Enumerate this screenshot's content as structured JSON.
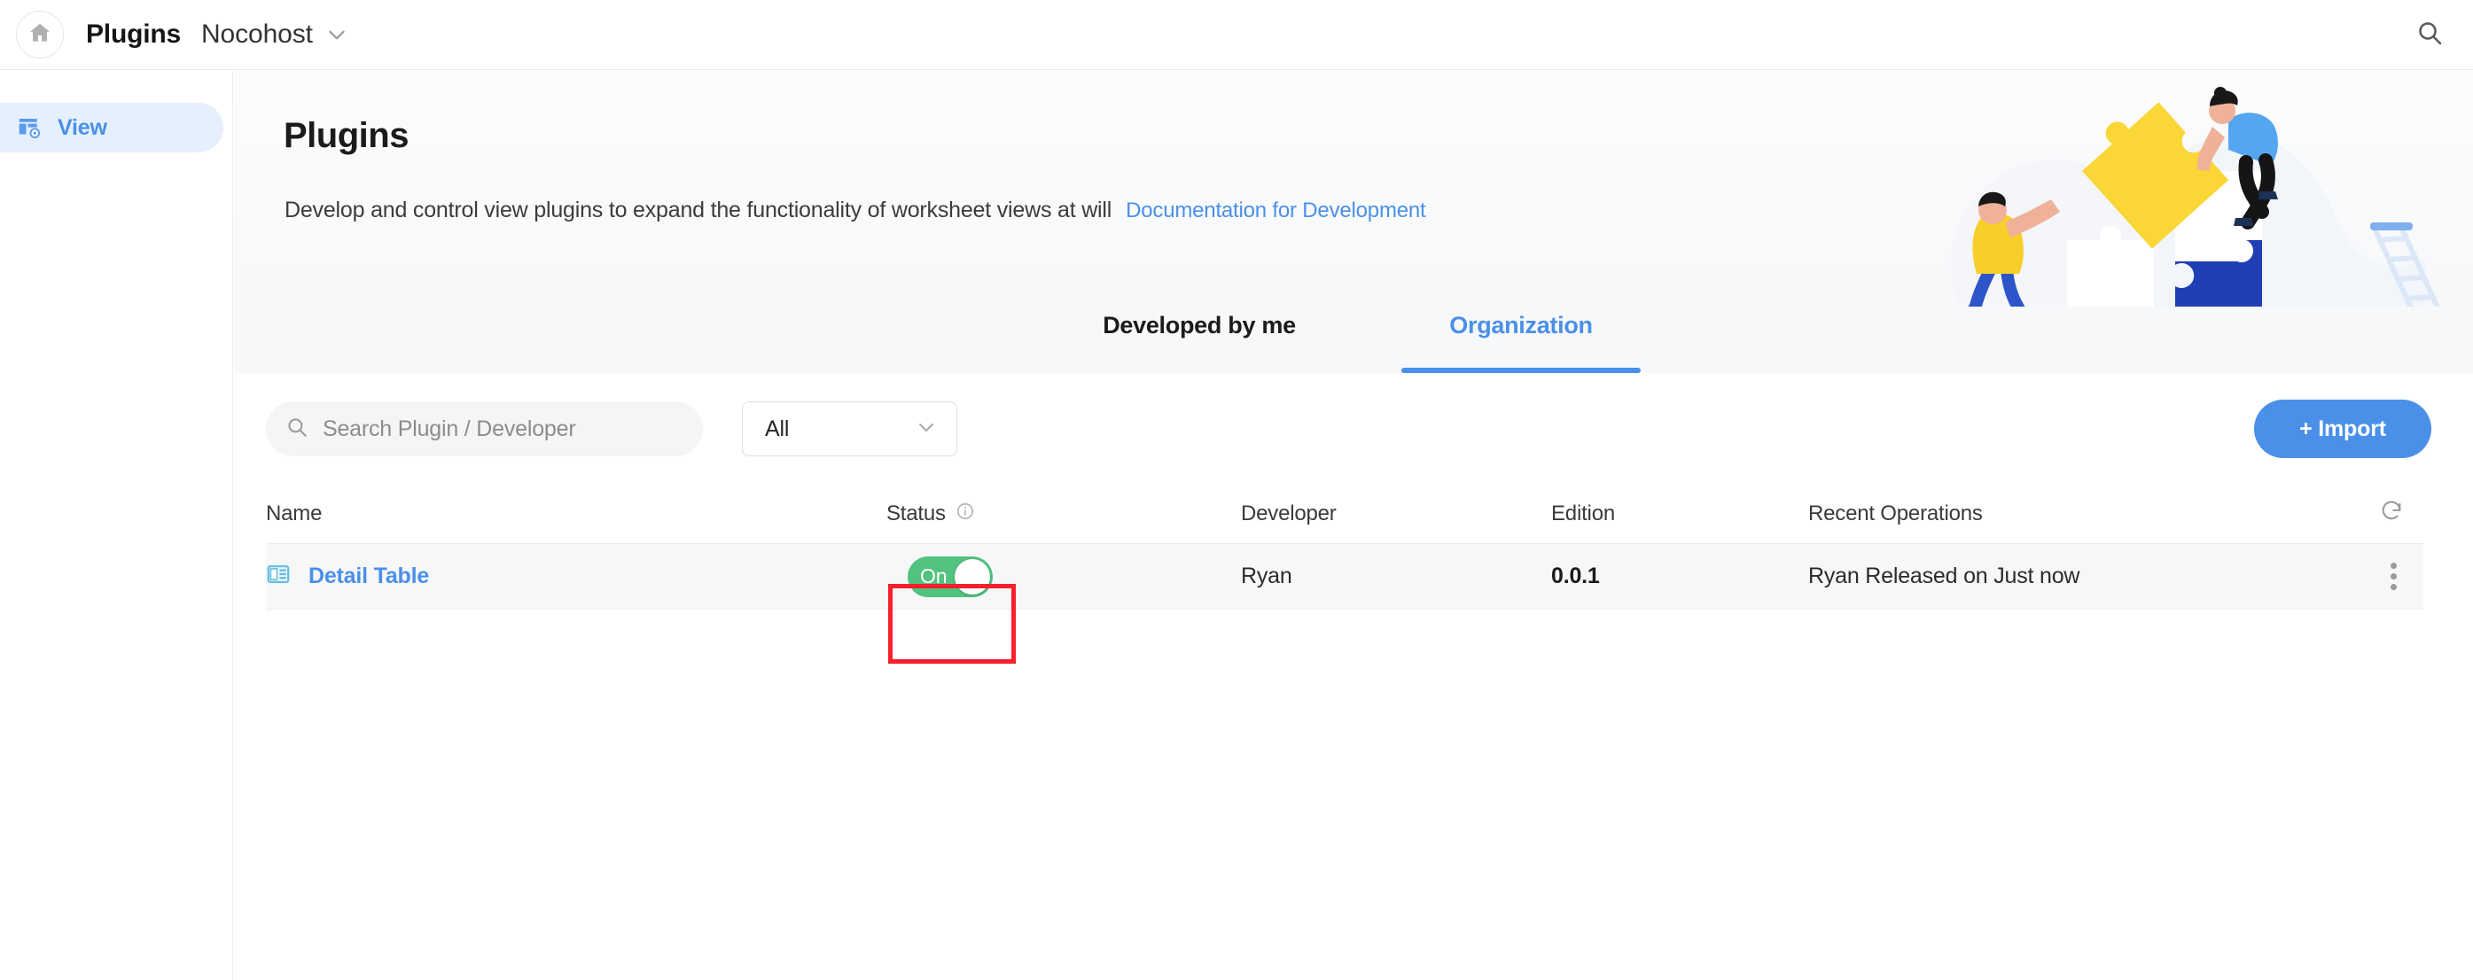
{
  "topbar": {
    "home_icon": "home-icon",
    "title": "Plugins",
    "org_name": "Nocohost",
    "caret_icon": "chevron-down-icon",
    "search_icon": "search-icon"
  },
  "sidebar": {
    "items": [
      {
        "label": "View",
        "icon": "view-table-icon",
        "active": true
      }
    ]
  },
  "hero": {
    "title": "Plugins",
    "description": "Develop and control view plugins to expand the functionality of worksheet views at will",
    "doc_link": "Documentation for Development",
    "illustration": "puzzle-teamwork-illustration"
  },
  "tabs": [
    {
      "id": "developed-by-me",
      "label": "Developed by me",
      "active": false
    },
    {
      "id": "organization",
      "label": "Organization",
      "active": true
    }
  ],
  "toolbar": {
    "search": {
      "placeholder": "Search Plugin / Developer",
      "value": "",
      "icon": "search-icon"
    },
    "filter": {
      "value": "All",
      "icon": "chevron-down-icon"
    },
    "import_label": "+ Import"
  },
  "table": {
    "columns": [
      {
        "key": "name",
        "label": "Name"
      },
      {
        "key": "status",
        "label": "Status",
        "info_icon": "info-circle-icon"
      },
      {
        "key": "developer",
        "label": "Developer"
      },
      {
        "key": "edition",
        "label": "Edition"
      },
      {
        "key": "operations",
        "label": "Recent Operations"
      }
    ],
    "refresh_icon": "refresh-icon",
    "rows": [
      {
        "icon": "detail-table-icon",
        "name": "Detail Table",
        "status": {
          "label": "On",
          "enabled": true,
          "highlighted": true
        },
        "developer": "Ryan",
        "edition": "0.0.1",
        "operations": "Ryan Released on Just now",
        "more_icon": "more-vertical-icon"
      }
    ]
  },
  "colors": {
    "accent": "#4a90e8",
    "toggle_on": "#52c27f",
    "highlight": "#f8202a",
    "hero_bg": "#f7f8fa",
    "sidebar_active_bg": "#e6f0fd"
  }
}
